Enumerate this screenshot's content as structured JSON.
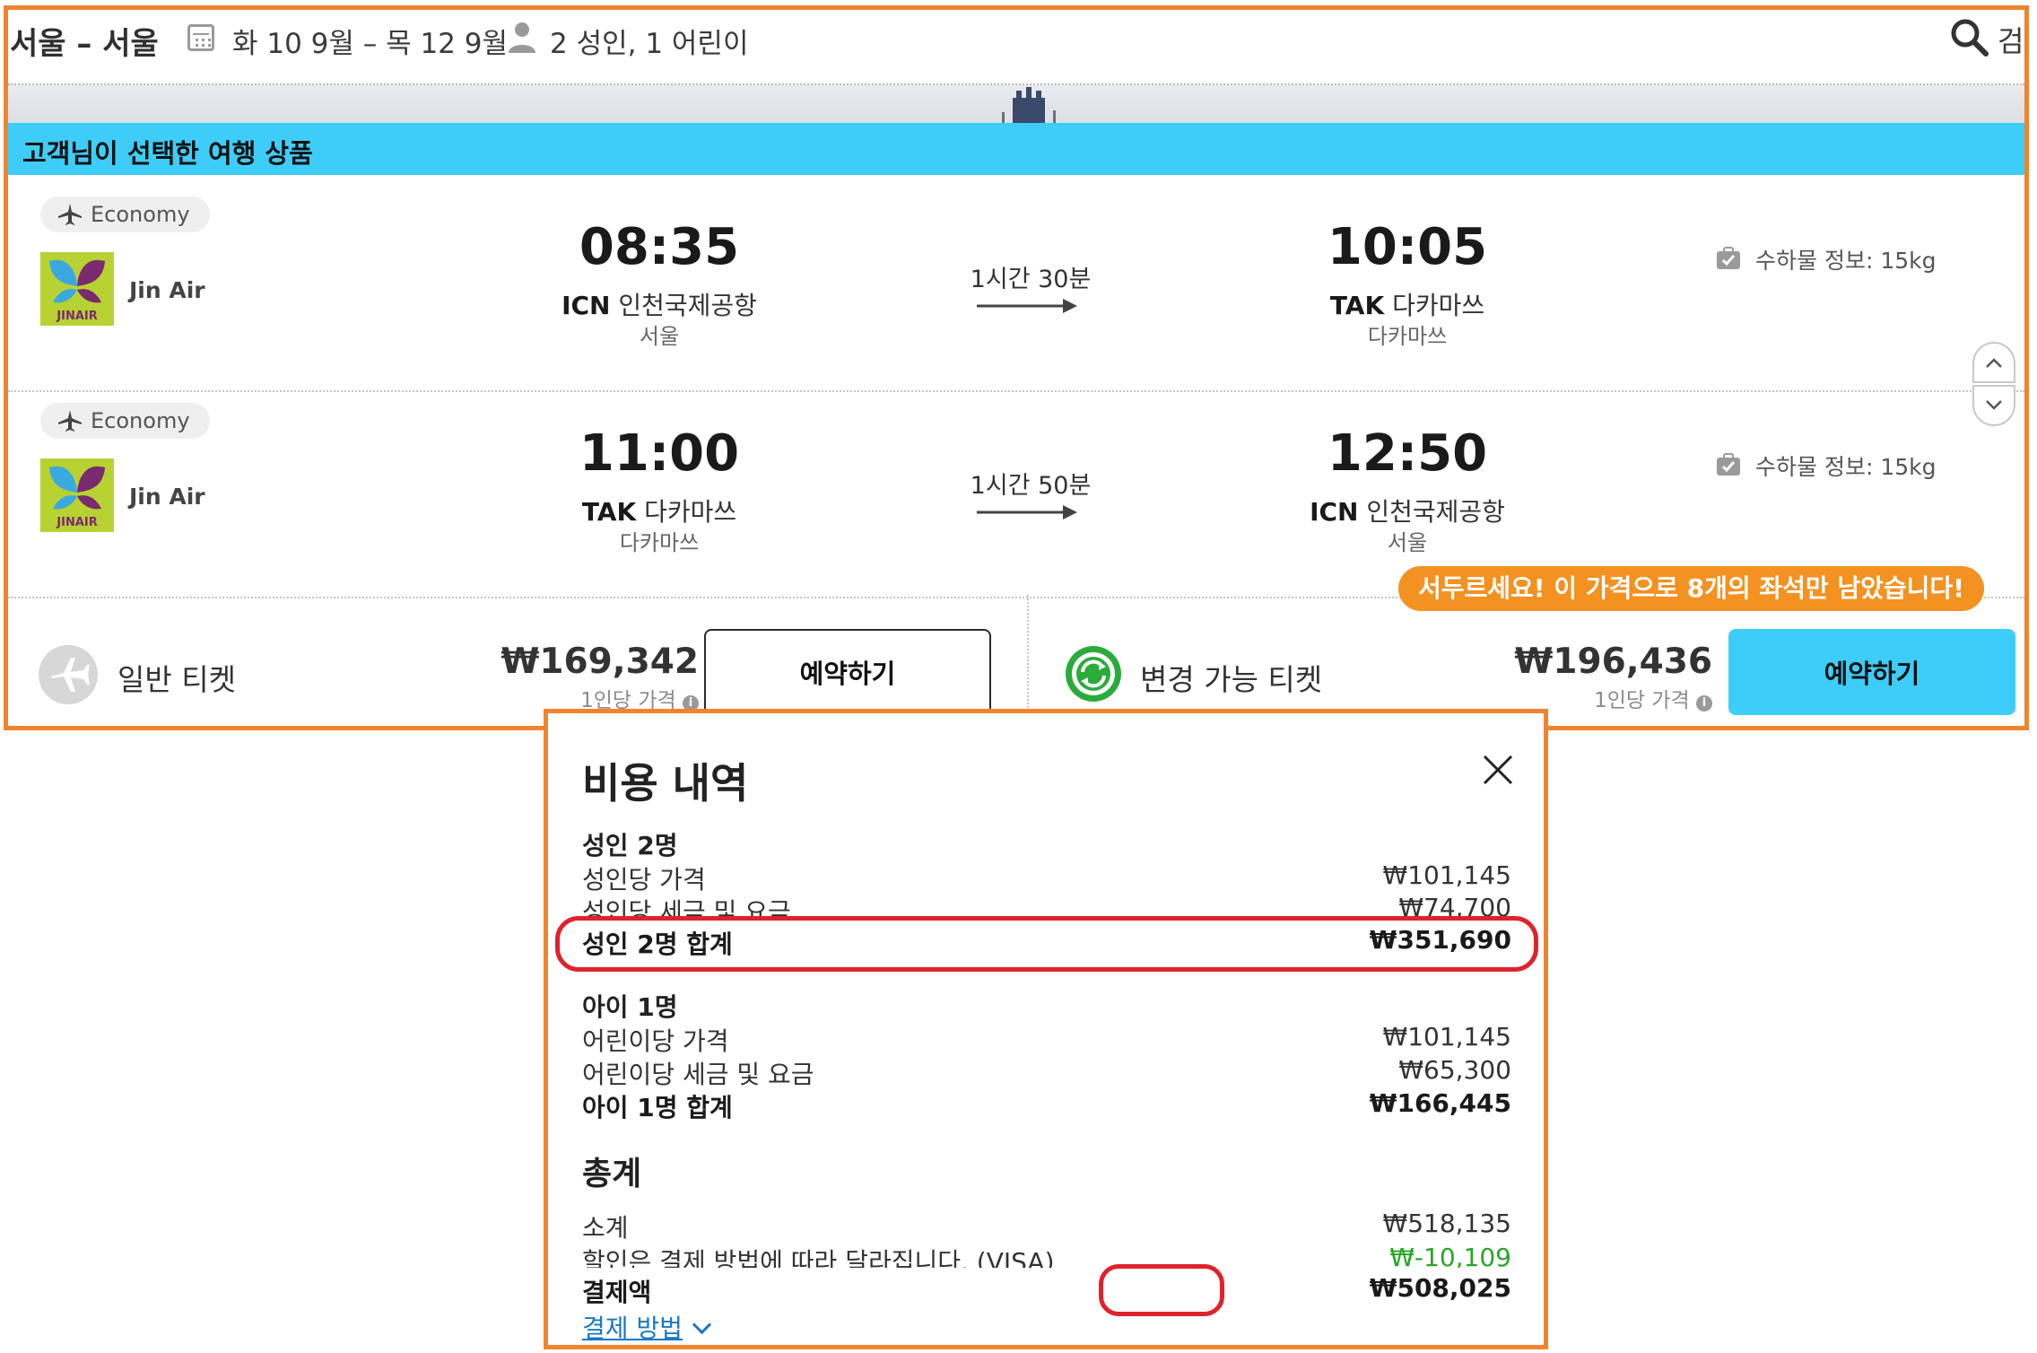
{
  "header": {
    "route": "서울 – 서울",
    "dates": "화 10 9월 – 목 12 9월",
    "travelers": "2 성인, 1 어린이",
    "search_label": "검색"
  },
  "banner": {
    "title": "고객님이 선택한 여행 상품"
  },
  "legs": [
    {
      "cabin": "Economy",
      "airline": "Jin Air",
      "depart_time": "08:35",
      "depart_code": "ICN",
      "depart_airport": "인천국제공항",
      "depart_city": "서울",
      "duration": "1시간 30분",
      "arrive_time": "10:05",
      "arrive_code": "TAK",
      "arrive_airport": "다카마쓰",
      "arrive_city": "다카마쓰",
      "baggage": "수하물 정보:  15kg"
    },
    {
      "cabin": "Economy",
      "airline": "Jin Air",
      "depart_time": "11:00",
      "depart_code": "TAK",
      "depart_airport": "다카마쓰",
      "depart_city": "다카마쓰",
      "duration": "1시간 50분",
      "arrive_time": "12:50",
      "arrive_code": "ICN",
      "arrive_airport": "인천국제공항",
      "arrive_city": "서울",
      "baggage": "수하물 정보:  15kg"
    }
  ],
  "urgency": "서두르세요! 이 가격으로 8개의 좌석만 남았습니다!",
  "tickets": {
    "standard": {
      "label": "일반 티켓",
      "price": "₩169,342",
      "per_person": "1인당 가격",
      "book": "예약하기"
    },
    "flexible": {
      "label": "변경 가능 티켓",
      "price": "₩196,436",
      "per_person": "1인당 가격",
      "book": "예약하기"
    }
  },
  "breakdown": {
    "title": "비용 내역",
    "adults": {
      "heading": "성인 2명",
      "price_label": "성인당 가격",
      "price": "₩101,145",
      "tax_label": "성인당 세금 및 요금",
      "tax": "₩74,700",
      "total_label": "성인 2명 합계",
      "total": "₩351,690"
    },
    "children": {
      "heading": "아이 1명",
      "price_label": "어린이당 가격",
      "price": "₩101,145",
      "tax_label": "어린이당 세금 및 요금",
      "tax": "₩65,300",
      "total_label": "아이 1명 합계",
      "total": "₩166,445"
    },
    "summary": {
      "heading": "총계",
      "subtotal_label": "소계",
      "subtotal": "₩518,135",
      "discount_label": "할인은 결제 방법에 따라 달라집니다. (VISA)",
      "discount": "₩-10,109",
      "pay_label": "결제액",
      "pay": "₩508,025",
      "method_link": "결제 방법"
    }
  },
  "colors": {
    "accent_blue": "#3ecdf8",
    "frame_orange": "#f0842e",
    "urgency_orange": "#f39121",
    "highlight_red": "#e0222b",
    "discount_green": "#2aa52a"
  }
}
